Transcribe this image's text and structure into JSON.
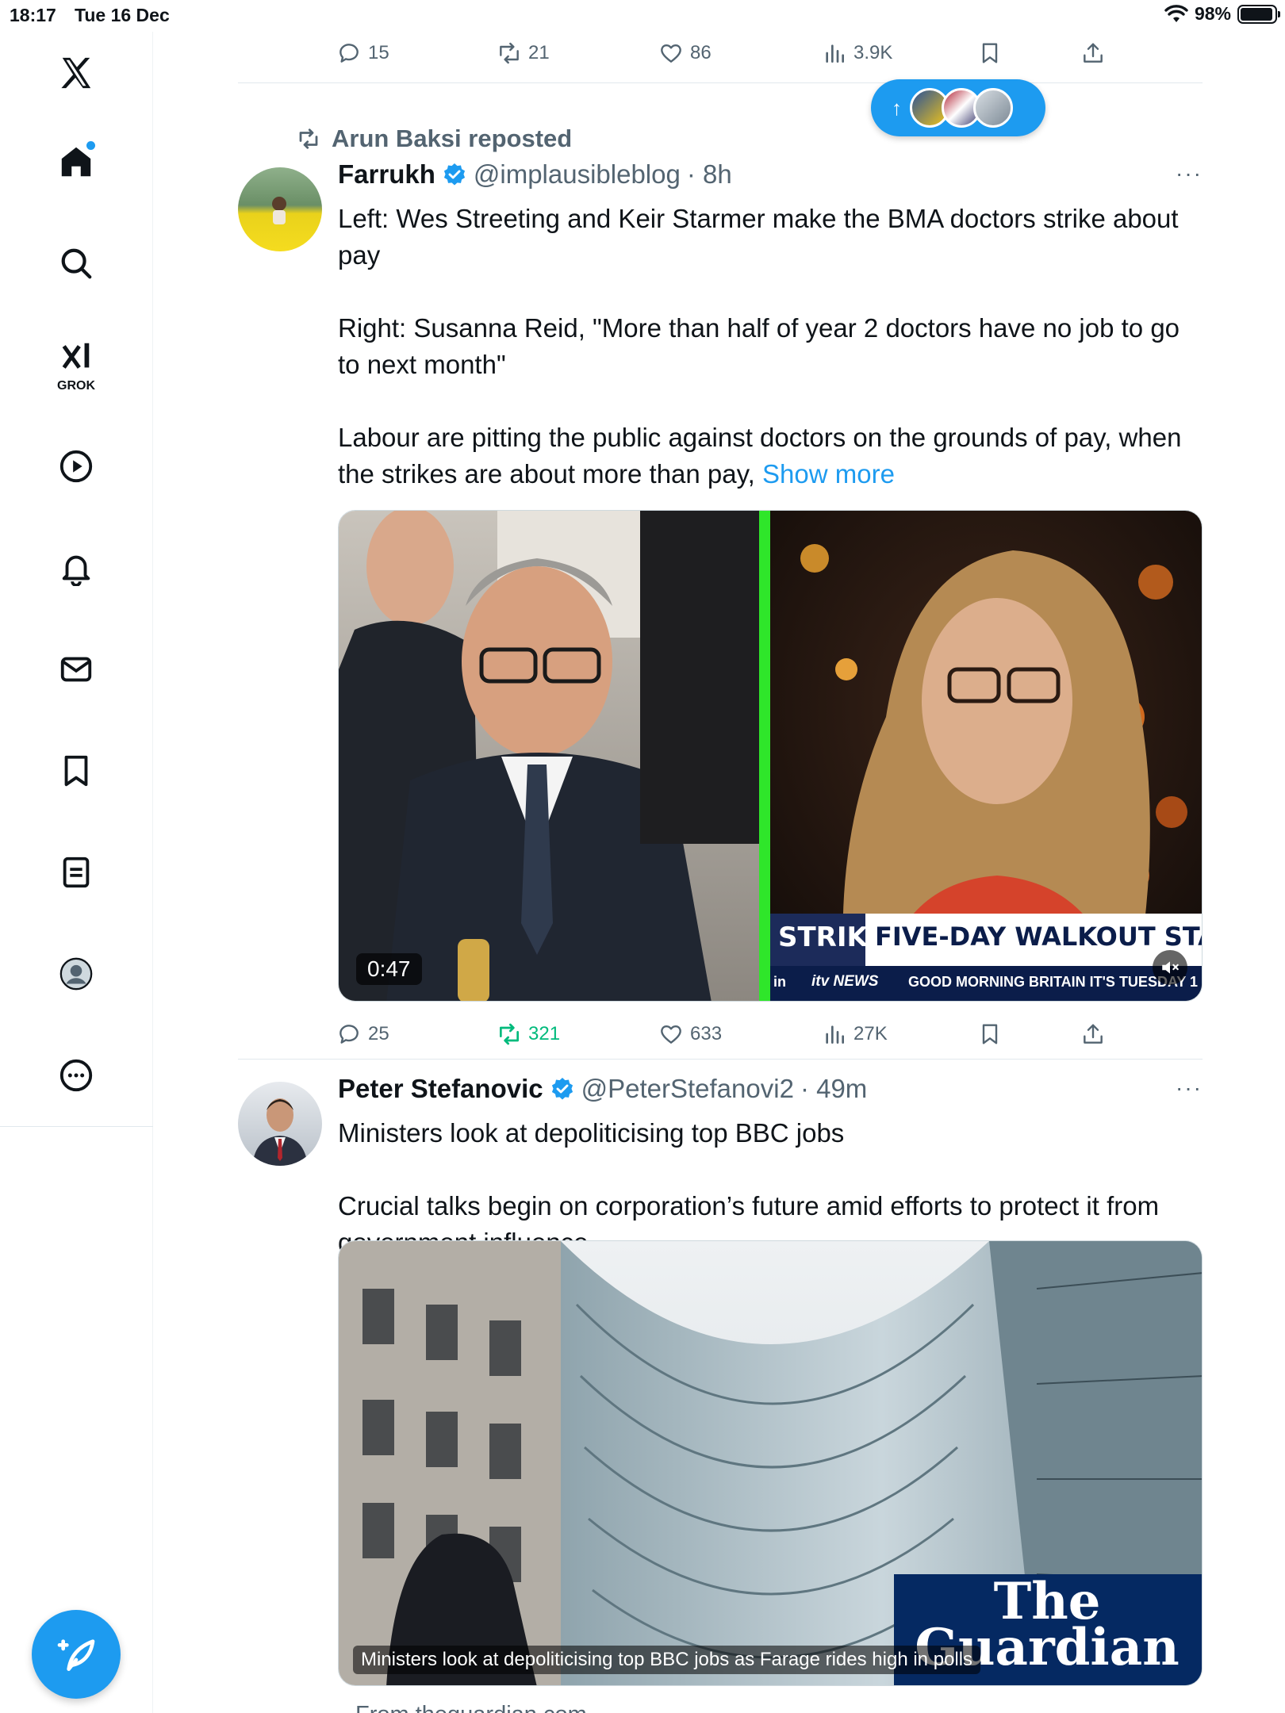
{
  "status_bar": {
    "time": "18:17",
    "date": "Tue 16 Dec",
    "battery": "98%",
    "battery_level": 0.98
  },
  "sidebar": {
    "grok_label": "GROK",
    "items": [
      "home",
      "search",
      "grok",
      "video",
      "notifications",
      "messages",
      "bookmarks",
      "lists",
      "profile",
      "more"
    ]
  },
  "previous_post_actions": {
    "replies": "15",
    "reposts": "21",
    "likes": "86",
    "views": "3.9K"
  },
  "new_posts_pill": {
    "arrow": "↑"
  },
  "post1": {
    "repost_by": "Arun Baksi reposted",
    "name": "Farrukh",
    "handle": "@implausibleblog",
    "time": "· 8h",
    "more": "···",
    "para1": "Left: Wes Streeting and Keir Starmer make the BMA doctors strike about pay",
    "para2": "Right: Susanna Reid, \"More than half of year 2 doctors have no job to go to next month\"",
    "para3": "Labour are pitting the public against doctors on the grounds of pay, when the strikes are about more than pay,",
    "show_more": "Show more",
    "video_duration": "0:47",
    "tv_strike": "STRIKE",
    "tv_headline": "FIVE-DAY WALKOUT STARTS T",
    "tv_left": "in",
    "tv_channel": "itv NEWS",
    "tv_ticker": "GOOD MORNING BRITAIN IT'S TUESDAY 1",
    "actions": {
      "replies": "25",
      "reposts": "321",
      "likes": "633",
      "views": "27K"
    }
  },
  "post2": {
    "name": "Peter Stefanovic",
    "handle": "@PeterStefanovi2",
    "time": "· 49m",
    "more": "···",
    "para1": "Ministers look at depoliticising top BBC jobs",
    "para2": "Crucial talks begin on corporation’s future amid efforts to protect it from government influence",
    "card_caption": "Ministers look at depoliticising top BBC jobs as Farage rides high in polls",
    "logo_line1": "The",
    "logo_line2": "Guardian",
    "source": "From theguardian.com"
  },
  "colors": {
    "accent": "#1d9bf0",
    "retweet": "#00ba7c",
    "muted": "#536471",
    "text": "#0f1419",
    "guardian_blue": "#052962"
  }
}
